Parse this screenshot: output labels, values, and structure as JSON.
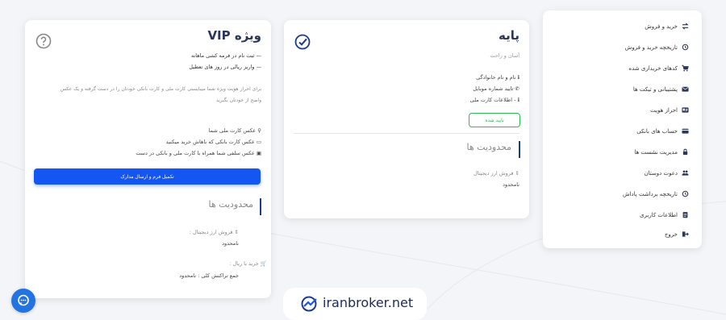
{
  "sidebar": {
    "items": [
      {
        "label": "خرید و فروش",
        "icon": "exchange-icon"
      },
      {
        "label": "تاریخچه خرید و فروش",
        "icon": "history-icon"
      },
      {
        "label": "کدهای خریداری شده",
        "icon": "cart-icon"
      },
      {
        "label": "پشتیبانی و تیکت ها",
        "icon": "envelope-icon"
      },
      {
        "label": "احراز هویت",
        "icon": "id-card-icon"
      },
      {
        "label": "حساب های بانکی",
        "icon": "bank-card-icon"
      },
      {
        "label": "مدیریت نشست ها",
        "icon": "lock-icon"
      },
      {
        "label": "دعوت دوستان",
        "icon": "users-icon"
      },
      {
        "label": "تاریخچه برداشت پاداش",
        "icon": "history-icon"
      },
      {
        "label": "اطلاعات کاربری",
        "icon": "clipboard-icon"
      },
      {
        "label": "خروج",
        "icon": "logout-icon"
      }
    ]
  },
  "basic": {
    "title": "پایه",
    "subtitle": "آسان و راحت",
    "features": [
      "نام و نام خانوادگی",
      "تایید شماره موبایل",
      "اطلاعات کارت ملی"
    ],
    "status": "تایید شده",
    "limits_title": "محدودیت ها",
    "limit_label": "فروش ارز دیجیتال",
    "limit_value": "نامحدود"
  },
  "vip": {
    "title": "ویژه VIP",
    "bullets": [
      "— ثبت نام در فرمه کشی ماهانه",
      "— واریز ریالی در روز های تعطیل"
    ],
    "description_line1": "برای احراز هویت ویژه شما میبایستی کارت ملی و کارت بانکی خودتان را در دست گرفته و یک عکس",
    "description_line2": "واضح از خودتان بگیرید",
    "requirements": [
      "عکس کارت ملی شما",
      "عکس کارت بانکی که باهاش خرید میکنید",
      "عکس سلفی شما همراه با کارت ملی و بانکی در دست"
    ],
    "button": "تکمیل فرم و ارسال مدارک",
    "limits_title": "محدودیت ها",
    "limit1_label": "فروش ارز دیجیتال :",
    "limit1_value": "نامحدود",
    "limit2_label": "خرید با ریال :",
    "limit2_value": "جمع تراکنش کلی : نامحدود"
  },
  "brand": {
    "name": "iranbroker.net"
  },
  "colors": {
    "primary": "#1456f2",
    "success": "#2dbb55",
    "navy": "#2c3657"
  }
}
